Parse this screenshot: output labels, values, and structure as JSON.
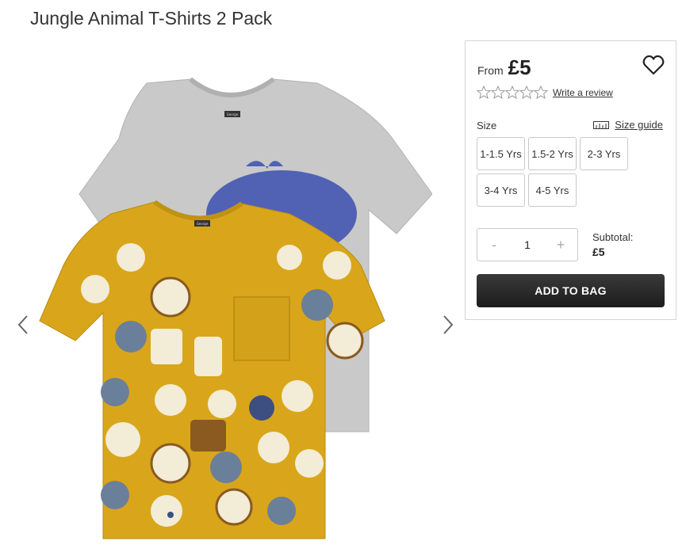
{
  "product": {
    "title": "Jungle Animal T-Shirts 2 Pack"
  },
  "purchase": {
    "from_label": "From",
    "price": "£5",
    "rating": 0,
    "review_link": "Write a review",
    "size_label": "Size",
    "size_guide": "Size guide",
    "sizes": [
      "1-1.5 Yrs",
      "1.5-2 Yrs",
      "2-3 Yrs",
      "3-4 Yrs",
      "4-5 Yrs"
    ],
    "quantity": {
      "minus": "-",
      "value": "1",
      "plus": "+"
    },
    "subtotal_label": "Subtotal:",
    "subtotal_value": "£5",
    "add_to_bag": "ADD TO BAG"
  },
  "shirt_labels": {
    "back": "George",
    "front": "George"
  },
  "colors": {
    "button_dark": "#262626",
    "shirt_grey": "#c7c7c7",
    "shirt_yellow": "#d9a61b",
    "whale_blue": "#3c4fb0"
  }
}
